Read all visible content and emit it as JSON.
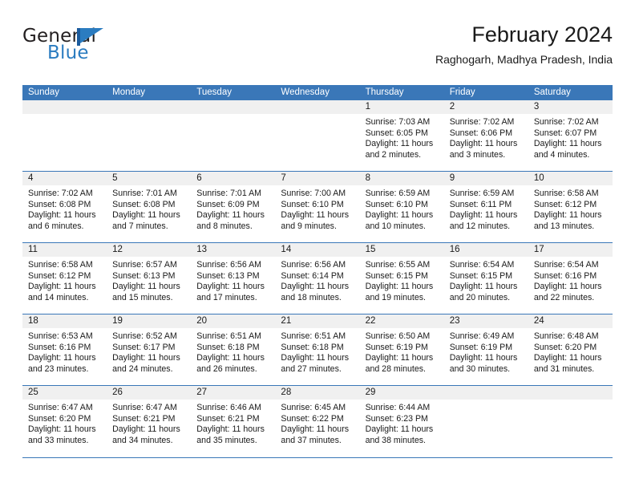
{
  "logo": {
    "word_top": "General",
    "word_bottom": "Blue",
    "flag_icon": "blue-triangle-flag-icon"
  },
  "header": {
    "title": "February 2024",
    "subtitle": "Raghogarh, Madhya Pradesh, India"
  },
  "colors": {
    "header_blue": "#3a77b8",
    "logo_blue": "#2b7cc0",
    "day_strip_gray": "#f0f0f0",
    "text": "#1a1a1a"
  },
  "weekdays": [
    "Sunday",
    "Monday",
    "Tuesday",
    "Wednesday",
    "Thursday",
    "Friday",
    "Saturday"
  ],
  "weeks": [
    [
      {
        "day": "",
        "lines": []
      },
      {
        "day": "",
        "lines": []
      },
      {
        "day": "",
        "lines": []
      },
      {
        "day": "",
        "lines": []
      },
      {
        "day": "1",
        "lines": [
          "Sunrise: 7:03 AM",
          "Sunset: 6:05 PM",
          "Daylight: 11 hours",
          "and 2 minutes."
        ]
      },
      {
        "day": "2",
        "lines": [
          "Sunrise: 7:02 AM",
          "Sunset: 6:06 PM",
          "Daylight: 11 hours",
          "and 3 minutes."
        ]
      },
      {
        "day": "3",
        "lines": [
          "Sunrise: 7:02 AM",
          "Sunset: 6:07 PM",
          "Daylight: 11 hours",
          "and 4 minutes."
        ]
      }
    ],
    [
      {
        "day": "4",
        "lines": [
          "Sunrise: 7:02 AM",
          "Sunset: 6:08 PM",
          "Daylight: 11 hours",
          "and 6 minutes."
        ]
      },
      {
        "day": "5",
        "lines": [
          "Sunrise: 7:01 AM",
          "Sunset: 6:08 PM",
          "Daylight: 11 hours",
          "and 7 minutes."
        ]
      },
      {
        "day": "6",
        "lines": [
          "Sunrise: 7:01 AM",
          "Sunset: 6:09 PM",
          "Daylight: 11 hours",
          "and 8 minutes."
        ]
      },
      {
        "day": "7",
        "lines": [
          "Sunrise: 7:00 AM",
          "Sunset: 6:10 PM",
          "Daylight: 11 hours",
          "and 9 minutes."
        ]
      },
      {
        "day": "8",
        "lines": [
          "Sunrise: 6:59 AM",
          "Sunset: 6:10 PM",
          "Daylight: 11 hours",
          "and 10 minutes."
        ]
      },
      {
        "day": "9",
        "lines": [
          "Sunrise: 6:59 AM",
          "Sunset: 6:11 PM",
          "Daylight: 11 hours",
          "and 12 minutes."
        ]
      },
      {
        "day": "10",
        "lines": [
          "Sunrise: 6:58 AM",
          "Sunset: 6:12 PM",
          "Daylight: 11 hours",
          "and 13 minutes."
        ]
      }
    ],
    [
      {
        "day": "11",
        "lines": [
          "Sunrise: 6:58 AM",
          "Sunset: 6:12 PM",
          "Daylight: 11 hours",
          "and 14 minutes."
        ]
      },
      {
        "day": "12",
        "lines": [
          "Sunrise: 6:57 AM",
          "Sunset: 6:13 PM",
          "Daylight: 11 hours",
          "and 15 minutes."
        ]
      },
      {
        "day": "13",
        "lines": [
          "Sunrise: 6:56 AM",
          "Sunset: 6:13 PM",
          "Daylight: 11 hours",
          "and 17 minutes."
        ]
      },
      {
        "day": "14",
        "lines": [
          "Sunrise: 6:56 AM",
          "Sunset: 6:14 PM",
          "Daylight: 11 hours",
          "and 18 minutes."
        ]
      },
      {
        "day": "15",
        "lines": [
          "Sunrise: 6:55 AM",
          "Sunset: 6:15 PM",
          "Daylight: 11 hours",
          "and 19 minutes."
        ]
      },
      {
        "day": "16",
        "lines": [
          "Sunrise: 6:54 AM",
          "Sunset: 6:15 PM",
          "Daylight: 11 hours",
          "and 20 minutes."
        ]
      },
      {
        "day": "17",
        "lines": [
          "Sunrise: 6:54 AM",
          "Sunset: 6:16 PM",
          "Daylight: 11 hours",
          "and 22 minutes."
        ]
      }
    ],
    [
      {
        "day": "18",
        "lines": [
          "Sunrise: 6:53 AM",
          "Sunset: 6:16 PM",
          "Daylight: 11 hours",
          "and 23 minutes."
        ]
      },
      {
        "day": "19",
        "lines": [
          "Sunrise: 6:52 AM",
          "Sunset: 6:17 PM",
          "Daylight: 11 hours",
          "and 24 minutes."
        ]
      },
      {
        "day": "20",
        "lines": [
          "Sunrise: 6:51 AM",
          "Sunset: 6:18 PM",
          "Daylight: 11 hours",
          "and 26 minutes."
        ]
      },
      {
        "day": "21",
        "lines": [
          "Sunrise: 6:51 AM",
          "Sunset: 6:18 PM",
          "Daylight: 11 hours",
          "and 27 minutes."
        ]
      },
      {
        "day": "22",
        "lines": [
          "Sunrise: 6:50 AM",
          "Sunset: 6:19 PM",
          "Daylight: 11 hours",
          "and 28 minutes."
        ]
      },
      {
        "day": "23",
        "lines": [
          "Sunrise: 6:49 AM",
          "Sunset: 6:19 PM",
          "Daylight: 11 hours",
          "and 30 minutes."
        ]
      },
      {
        "day": "24",
        "lines": [
          "Sunrise: 6:48 AM",
          "Sunset: 6:20 PM",
          "Daylight: 11 hours",
          "and 31 minutes."
        ]
      }
    ],
    [
      {
        "day": "25",
        "lines": [
          "Sunrise: 6:47 AM",
          "Sunset: 6:20 PM",
          "Daylight: 11 hours",
          "and 33 minutes."
        ]
      },
      {
        "day": "26",
        "lines": [
          "Sunrise: 6:47 AM",
          "Sunset: 6:21 PM",
          "Daylight: 11 hours",
          "and 34 minutes."
        ]
      },
      {
        "day": "27",
        "lines": [
          "Sunrise: 6:46 AM",
          "Sunset: 6:21 PM",
          "Daylight: 11 hours",
          "and 35 minutes."
        ]
      },
      {
        "day": "28",
        "lines": [
          "Sunrise: 6:45 AM",
          "Sunset: 6:22 PM",
          "Daylight: 11 hours",
          "and 37 minutes."
        ]
      },
      {
        "day": "29",
        "lines": [
          "Sunrise: 6:44 AM",
          "Sunset: 6:23 PM",
          "Daylight: 11 hours",
          "and 38 minutes."
        ]
      },
      {
        "day": "",
        "lines": []
      },
      {
        "day": "",
        "lines": []
      }
    ]
  ]
}
